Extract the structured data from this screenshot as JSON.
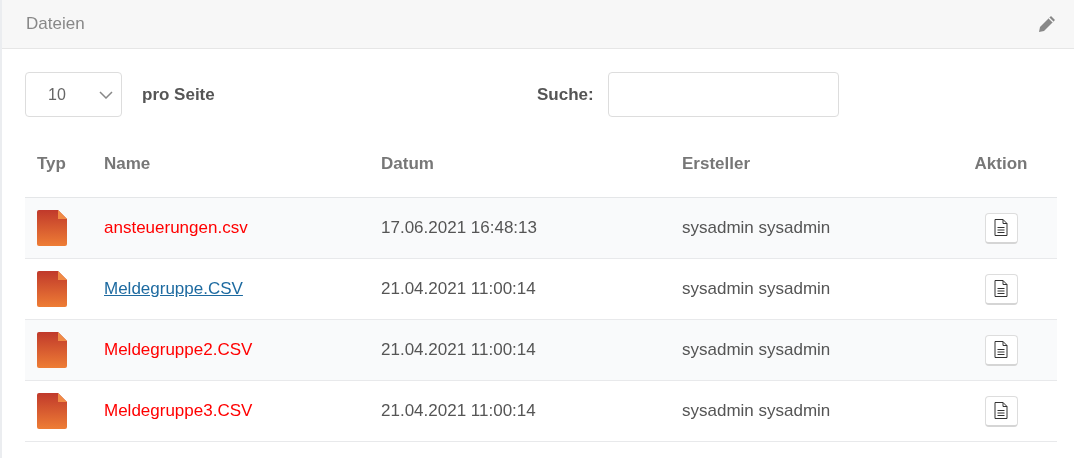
{
  "panel": {
    "title": "Dateien"
  },
  "page_size": {
    "value": "10",
    "label": "pro Seite"
  },
  "search": {
    "label": "Suche:"
  },
  "table": {
    "columns": [
      "Typ",
      "Name",
      "Datum",
      "Ersteller",
      "Aktion"
    ],
    "rows": [
      {
        "name": "ansteuerungen.csv",
        "hovered": false,
        "date": "17.06.2021 16:48:13",
        "creator": "sysadmin sysadmin"
      },
      {
        "name": "Meldegruppe.CSV",
        "hovered": true,
        "date": "21.04.2021 11:00:14",
        "creator": "sysadmin sysadmin"
      },
      {
        "name": "Meldegruppe2.CSV",
        "hovered": false,
        "date": "21.04.2021 11:00:14",
        "creator": "sysadmin sysadmin"
      },
      {
        "name": "Meldegruppe3.CSV",
        "hovered": false,
        "date": "21.04.2021 11:00:14",
        "creator": "sysadmin sysadmin"
      }
    ]
  }
}
